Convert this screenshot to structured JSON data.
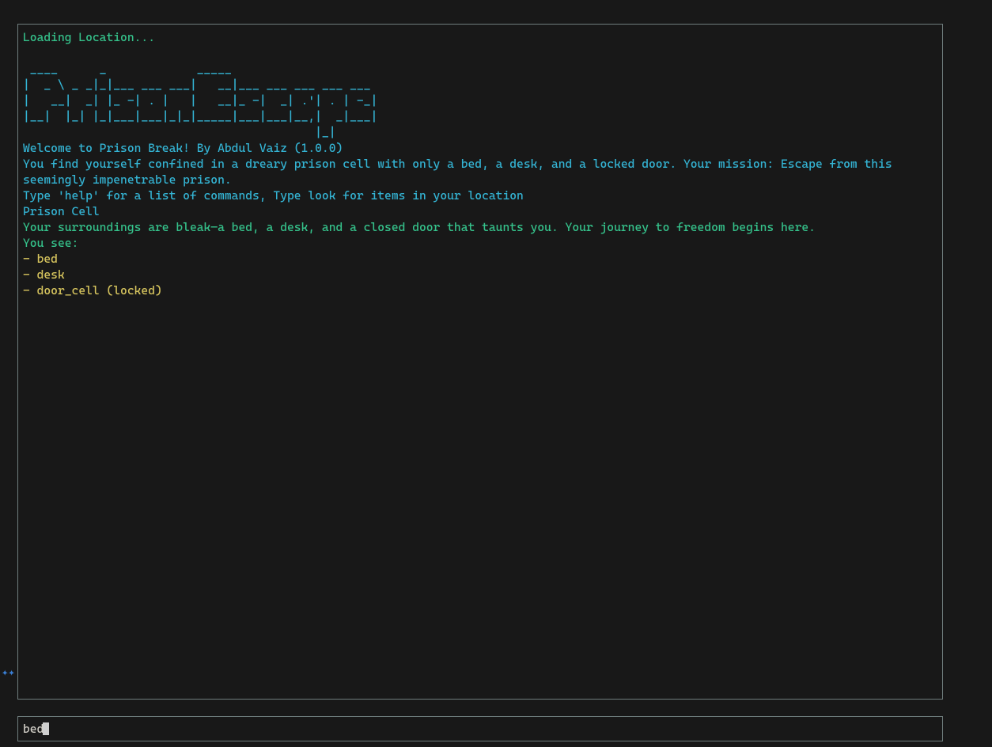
{
  "status": "Loading Location...",
  "ascii_banner": " ____      _             _____\n|  _ \\ _ _|_|___ ___ ___|   __|___ ___ ___ ___ ___\n|   __|  _| |_ -| . |   |   __|_ -|  _| .'| . | -_|\n|__|  |_| |_|___|___|_|_|_____|___|___|__,|  _|___|\n                                          |_|",
  "welcome": "Welcome to Prison Break! By Abdul Vaiz (1.0.0)",
  "intro": "You find yourself confined in a dreary prison cell with only a bed, a desk, and a locked door. Your mission: Escape from this\nseemingly impenetrable prison.",
  "help_hint": "Type 'help' for a list of commands, Type look for items in your location",
  "location_name": "Prison Cell",
  "location_desc": "Your surroundings are bleak—a bed, a desk, and a closed door that taunts you. Your journey to freedom begins here.",
  "items_header": "You see:",
  "items": [
    "- bed",
    "- desk",
    "- door_cell (locked)"
  ],
  "input_value": "bed"
}
